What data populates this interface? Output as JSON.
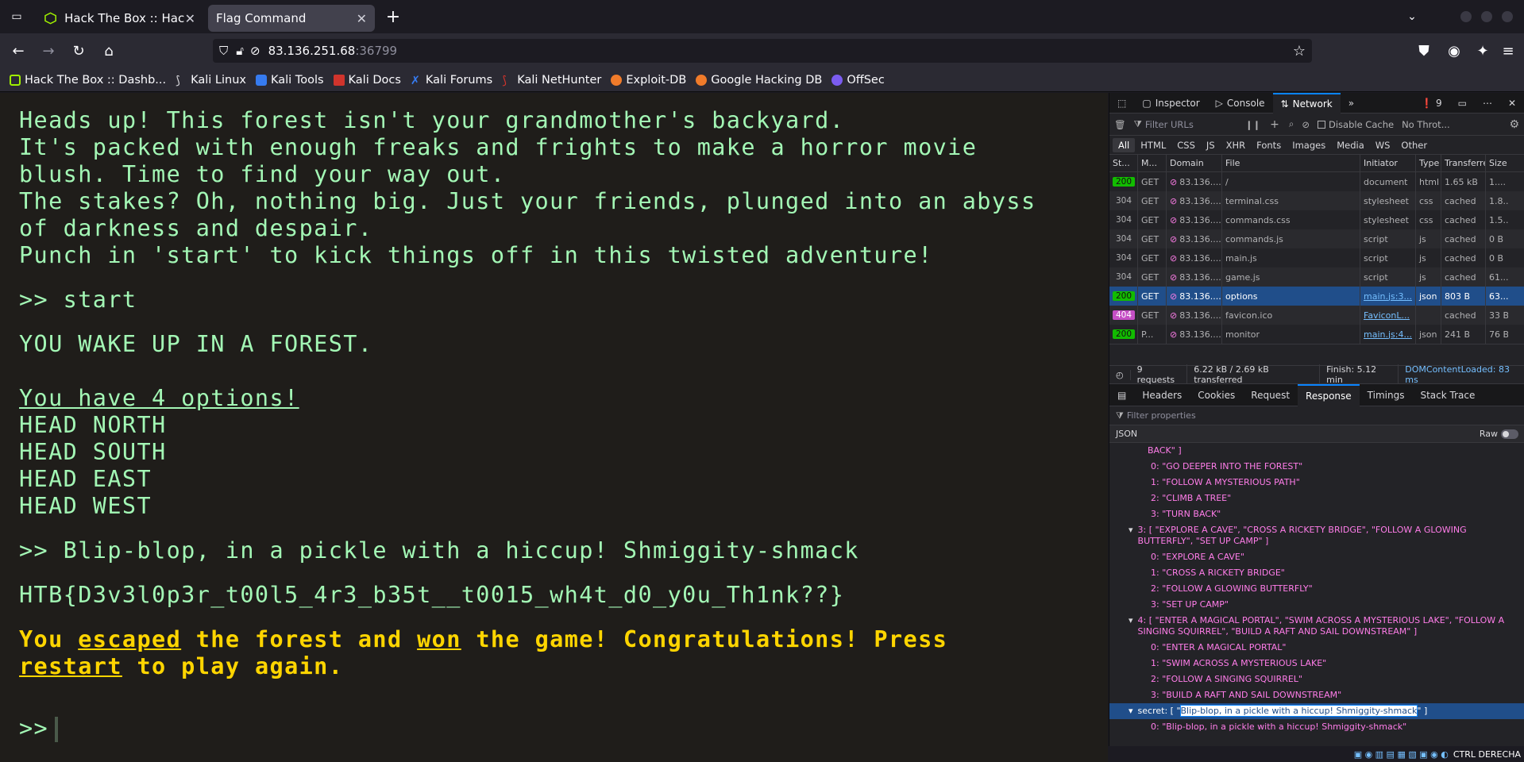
{
  "tabs": [
    {
      "title": "Hack The Box :: Hack The",
      "active": false
    },
    {
      "title": "Flag Command",
      "active": true
    }
  ],
  "url": {
    "host": "83.136.251.68",
    "port": ":36799"
  },
  "bookmarks": [
    "Hack The Box :: Dashb...",
    "Kali Linux",
    "Kali Tools",
    "Kali Docs",
    "Kali Forums",
    "Kali NetHunter",
    "Exploit-DB",
    "Google Hacking DB",
    "OffSec"
  ],
  "terminal": {
    "intro": [
      "Heads up! This forest isn't your grandmother's backyard.",
      "It's packed with enough freaks and frights to make a horror movie",
      "blush. Time to find your way out.",
      "The stakes? Oh, nothing big. Just your friends, plunged into an abyss",
      "of darkness and despair.",
      "Punch in 'start' to kick things off in this twisted adventure!"
    ],
    "cmd1": ">> start",
    "wake": "YOU WAKE UP IN A FOREST.",
    "options_header": "You have 4 options!",
    "options": [
      "HEAD NORTH",
      "HEAD SOUTH",
      "HEAD EAST",
      "HEAD WEST"
    ],
    "cmd2": ">> Blip-blop, in a pickle with a hiccup! Shmiggity-shmack",
    "flag": "HTB{D3v3l0p3r_t00l5_4r3_b35t__t0015_wh4t_d0_y0u_Th1nk??}",
    "win": {
      "w1": "You ",
      "w2": "escaped",
      "w3": " the forest and ",
      "w4": "won",
      "w5": " the game! Congratulations! Press",
      "w6": "restart",
      "w7": " to play again."
    },
    "prompt": ">>"
  },
  "devtools": {
    "tabs": [
      "Inspector",
      "Console",
      "Network"
    ],
    "errors": "9",
    "filter_placeholder": "Filter URLs",
    "disable_cache": "Disable Cache",
    "throttle": "No Throt...",
    "types": [
      "All",
      "HTML",
      "CSS",
      "JS",
      "XHR",
      "Fonts",
      "Images",
      "Media",
      "WS",
      "Other"
    ],
    "columns": [
      "St...",
      "M...",
      "Domain",
      "File",
      "Initiator",
      "Type",
      "Transferred",
      "Size"
    ],
    "rows": [
      {
        "status": "200",
        "method": "GET",
        "domain": "83.136....",
        "file": "/",
        "initiator": "document",
        "type": "html",
        "transferred": "1.65 kB",
        "size": "1....",
        "link": false
      },
      {
        "status": "304",
        "method": "GET",
        "domain": "83.136....",
        "file": "terminal.css",
        "initiator": "stylesheet",
        "type": "css",
        "transferred": "cached",
        "size": "1.8...",
        "link": false
      },
      {
        "status": "304",
        "method": "GET",
        "domain": "83.136....",
        "file": "commands.css",
        "initiator": "stylesheet",
        "type": "css",
        "transferred": "cached",
        "size": "1.5...",
        "link": false
      },
      {
        "status": "304",
        "method": "GET",
        "domain": "83.136....",
        "file": "commands.js",
        "initiator": "script",
        "type": "js",
        "transferred": "cached",
        "size": "0 B",
        "link": false
      },
      {
        "status": "304",
        "method": "GET",
        "domain": "83.136....",
        "file": "main.js",
        "initiator": "script",
        "type": "js",
        "transferred": "cached",
        "size": "0 B",
        "link": false
      },
      {
        "status": "304",
        "method": "GET",
        "domain": "83.136....",
        "file": "game.js",
        "initiator": "script",
        "type": "js",
        "transferred": "cached",
        "size": "61....",
        "link": false
      },
      {
        "status": "200",
        "method": "GET",
        "domain": "83.136....",
        "file": "options",
        "initiator": "main.js:3...",
        "type": "json",
        "transferred": "803 B",
        "size": "63....",
        "link": true,
        "selected": true
      },
      {
        "status": "404",
        "method": "GET",
        "domain": "83.136....",
        "file": "favicon.ico",
        "initiator": "FaviconL...",
        "type": "",
        "transferred": "cached",
        "size": "33 B",
        "link": true
      },
      {
        "status": "200",
        "method": "P...",
        "domain": "83.136....",
        "file": "monitor",
        "initiator": "main.js:4...",
        "type": "json",
        "transferred": "241 B",
        "size": "76 B",
        "link": true
      }
    ],
    "summary": {
      "requests": "9 requests",
      "size": "6.22 kB / 2.69 kB transferred",
      "finish": "Finish: 5.12 min",
      "dom": "DOMContentLoaded: 83 ms"
    },
    "detail_tabs": [
      "Headers",
      "Cookies",
      "Request",
      "Response",
      "Timings",
      "Stack Trace"
    ],
    "filter_props": "Filter properties",
    "json_label": "JSON",
    "raw_label": "Raw",
    "json": {
      "partial_top": "BACK\" ]",
      "g2": [
        "0: \"GO DEEPER INTO THE FOREST\"",
        "1: \"FOLLOW A MYSTERIOUS PATH\"",
        "2: \"CLIMB A TREE\"",
        "3: \"TURN BACK\""
      ],
      "g3_head": "3: [ \"EXPLORE A CAVE\", \"CROSS A RICKETY BRIDGE\", \"FOLLOW A GLOWING BUTTERFLY\", \"SET UP CAMP\" ]",
      "g3": [
        "0: \"EXPLORE A CAVE\"",
        "1: \"CROSS A RICKETY BRIDGE\"",
        "2: \"FOLLOW A GLOWING BUTTERFLY\"",
        "3: \"SET UP CAMP\""
      ],
      "g4_head": "4: [ \"ENTER A MAGICAL PORTAL\", \"SWIM ACROSS A MYSTERIOUS LAKE\", \"FOLLOW A SINGING SQUIRREL\", \"BUILD A RAFT AND SAIL DOWNSTREAM\" ]",
      "g4": [
        "0: \"ENTER A MAGICAL PORTAL\"",
        "1: \"SWIM ACROSS A MYSTERIOUS LAKE\"",
        "2: \"FOLLOW A SINGING SQUIRREL\"",
        "3: \"BUILD A RAFT AND SAIL DOWNSTREAM\""
      ],
      "secret_key": "secret:",
      "secret_val": "Blip-blop, in a pickle with a hiccup! Shmiggity-shmack",
      "secret_item": "0: \"Blip-blop, in a pickle with a hiccup! Shmiggity-shmack\""
    }
  },
  "statusbar": "CTRL DERECHA"
}
